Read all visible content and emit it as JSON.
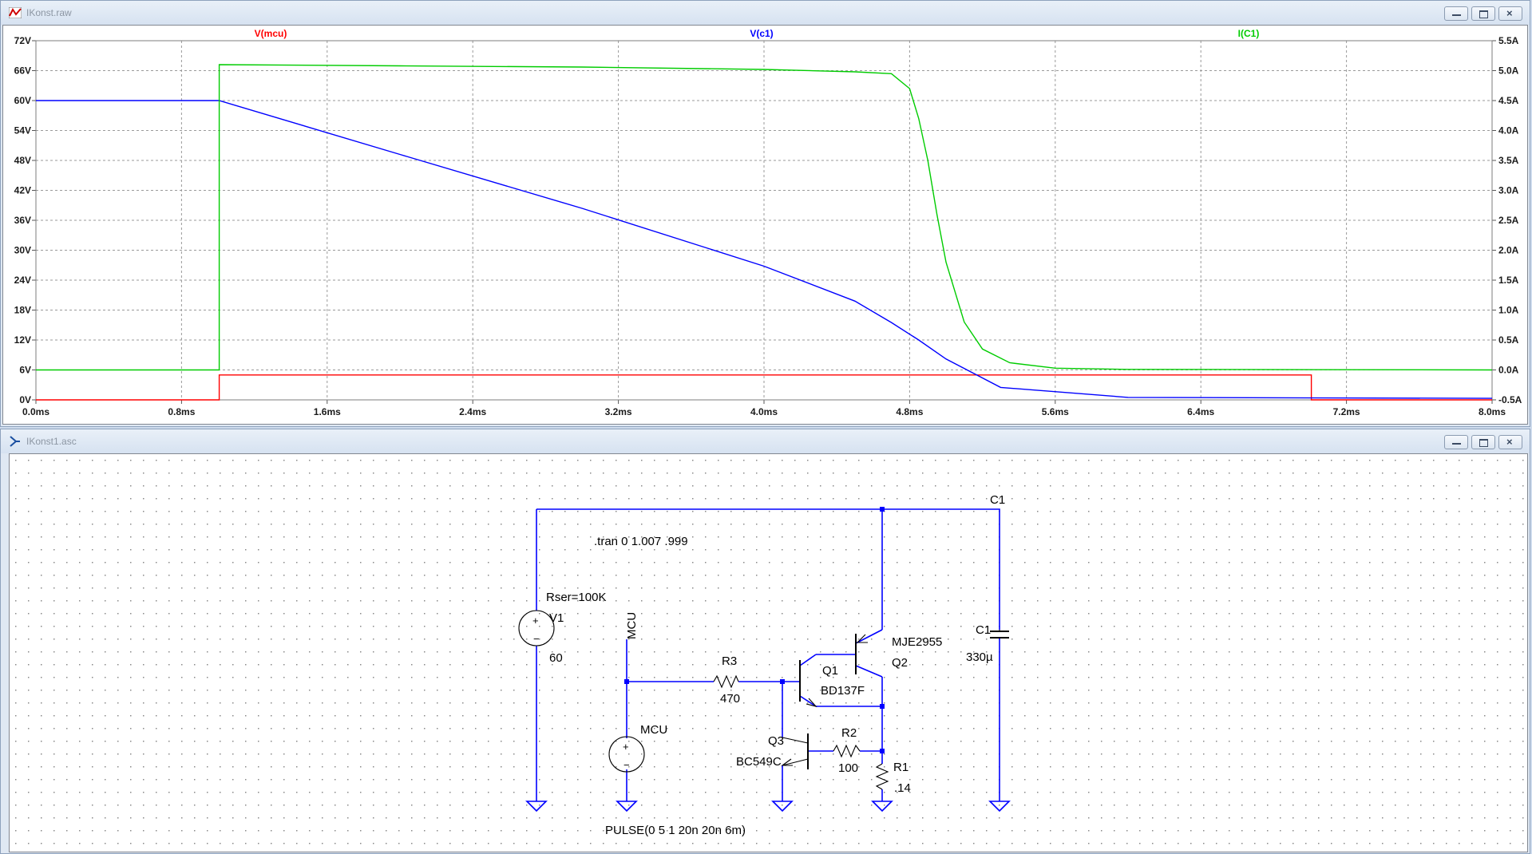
{
  "waveform_window": {
    "title": "IKonst.raw",
    "traces": [
      {
        "name": "V(mcu)",
        "color": "#ff0000"
      },
      {
        "name": "V(c1)",
        "color": "#0000ff"
      },
      {
        "name": "I(C1)",
        "color": "#00cc00"
      }
    ],
    "left_axis_ticks": [
      "72V",
      "66V",
      "60V",
      "54V",
      "48V",
      "42V",
      "36V",
      "30V",
      "24V",
      "18V",
      "12V",
      "6V",
      "0V"
    ],
    "right_axis_ticks": [
      "5.5A",
      "5.0A",
      "4.5A",
      "4.0A",
      "3.5A",
      "3.0A",
      "2.5A",
      "2.0A",
      "1.5A",
      "1.0A",
      "0.5A",
      "0.0A",
      "-0.5A"
    ],
    "x_axis_ticks": [
      "0.0ms",
      "0.8ms",
      "1.6ms",
      "2.4ms",
      "3.2ms",
      "4.0ms",
      "4.8ms",
      "5.6ms",
      "6.4ms",
      "7.2ms",
      "8.0ms"
    ]
  },
  "chart_data": {
    "type": "line",
    "xlim": [
      0,
      8
    ],
    "ylim_left": [
      0,
      72
    ],
    "ylim_right": [
      -0.5,
      5.5
    ],
    "grid": true,
    "legend": "top",
    "series": [
      {
        "name": "V(mcu)",
        "axis": "left",
        "color": "#ff0000",
        "x": [
          0,
          1.007,
          1.007,
          7.007,
          7.007,
          8.0
        ],
        "y": [
          0,
          0,
          5,
          5,
          0,
          0
        ]
      },
      {
        "name": "V(c1)",
        "axis": "left",
        "color": "#0000ff",
        "x": [
          0,
          1.0,
          1.007,
          2.0,
          3.0,
          4.0,
          4.5,
          4.7,
          4.85,
          5.0,
          5.3,
          6.0,
          8.0
        ],
        "y": [
          60,
          60,
          60,
          49.2,
          38.4,
          26.8,
          19.8,
          15.5,
          12.0,
          8.2,
          2.5,
          0.5,
          0.3
        ]
      },
      {
        "name": "I(C1)",
        "axis": "right",
        "color": "#00cc00",
        "x": [
          0,
          1.007,
          1.007,
          2.0,
          3.0,
          4.0,
          4.5,
          4.7,
          4.8,
          4.85,
          4.9,
          4.95,
          5.0,
          5.1,
          5.2,
          5.35,
          5.6,
          6.0,
          8.0
        ],
        "y": [
          0,
          0,
          5.1,
          5.08,
          5.06,
          5.02,
          4.98,
          4.95,
          4.7,
          4.2,
          3.5,
          2.6,
          1.8,
          0.8,
          0.35,
          0.12,
          0.03,
          0.01,
          0.0
        ]
      }
    ]
  },
  "schematic_window": {
    "title": "IKonst1.asc",
    "directive": ".tran 0 1.007 .999",
    "pulse": "PULSE(0 5 1 20n 20n 6m)",
    "labels": {
      "rser": "Rser=100K",
      "v1_name": "V1",
      "v1_value": "60",
      "mcu_net": "MCU",
      "mcu_source": "MCU",
      "r3_name": "R3",
      "r3_value": "470",
      "q1_name": "Q1",
      "q1_model": "BD137F",
      "q2_model": "MJE2955",
      "q2_name": "Q2",
      "q3_name": "Q3",
      "q3_model": "BC549C",
      "r2_name": "R2",
      "r2_value": "100",
      "r1_name": "R1",
      "r1_value": ".14",
      "c1_top": "C1",
      "c1_name": "C1",
      "c1_value": "330µ"
    }
  }
}
